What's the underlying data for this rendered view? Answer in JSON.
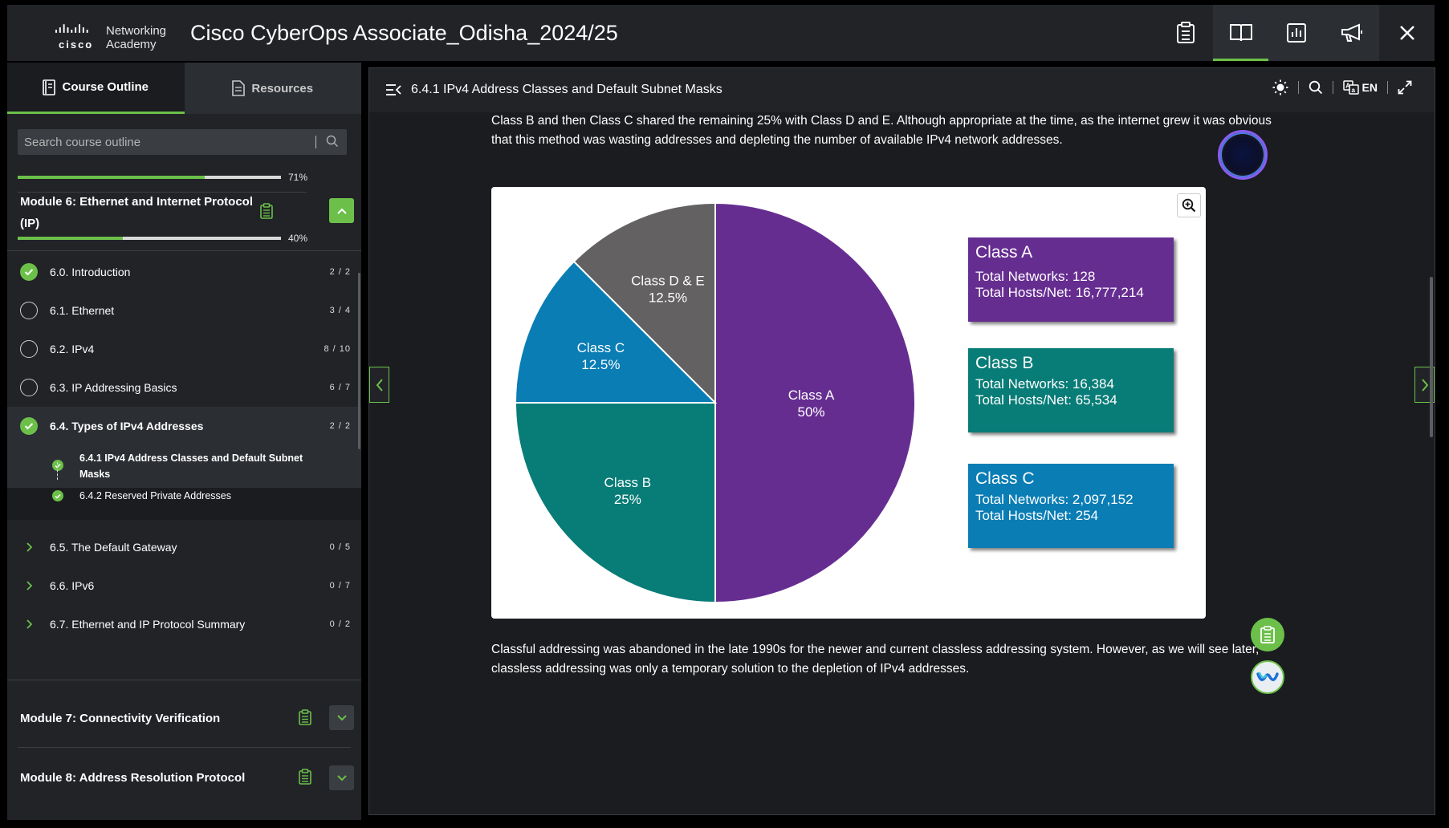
{
  "app": {
    "title": "Cisco CyberOps Associate_Odisha_2024/25",
    "logo_brand": "cisco",
    "logo_line1": "Networking",
    "logo_line2": "Academy"
  },
  "top_icons": [
    {
      "name": "assignments-icon",
      "active": false
    },
    {
      "name": "book-icon",
      "active": true
    },
    {
      "name": "grades-chart-icon",
      "active": false
    },
    {
      "name": "announcements-megaphone-icon",
      "active": false
    },
    {
      "name": "close-icon",
      "active": false
    }
  ],
  "sidebar": {
    "tabs": [
      {
        "label": "Course Outline",
        "icon": "outline-icon",
        "active": true
      },
      {
        "label": "Resources",
        "icon": "document-icon",
        "active": false
      }
    ],
    "search_placeholder": "Search course outline",
    "overall_progress": {
      "value": 0.71,
      "label": "71%"
    },
    "module6": {
      "title_line1": "Module 6: Ethernet and Internet Protocol",
      "title_line2": "(IP)",
      "progress": {
        "value": 0.4,
        "label": "40%"
      }
    },
    "items": [
      {
        "label": "6.0. Introduction",
        "count": "2 / 2",
        "status": "done"
      },
      {
        "label": "6.1. Ethernet",
        "count": "3 / 4",
        "status": "empty"
      },
      {
        "label": "6.2. IPv4",
        "count": "8 / 10",
        "status": "empty"
      },
      {
        "label": "6.3. IP Addressing Basics",
        "count": "6 / 7",
        "status": "empty"
      },
      {
        "label": "6.4. Types of IPv4 Addresses",
        "count": "2 / 2",
        "status": "done"
      }
    ],
    "sub_items": [
      {
        "label_line1": "6.4.1 IPv4 Address Classes and Default Subnet",
        "label_line2": "Masks"
      },
      {
        "label": "6.4.2 Reserved Private Addresses"
      }
    ],
    "collapsed_items": [
      {
        "label": "6.5. The Default Gateway",
        "count": "0 / 5"
      },
      {
        "label": "6.6. IPv6",
        "count": "0 / 7"
      },
      {
        "label": "6.7. Ethernet and IP Protocol Summary",
        "count": "0 / 2"
      }
    ],
    "other_modules": [
      {
        "title": "Module 7: Connectivity Verification"
      },
      {
        "title": "Module 8: Address Resolution Protocol"
      }
    ]
  },
  "main": {
    "page_title": "6.4.1 IPv4 Address Classes and Default Subnet Masks",
    "language": "EN",
    "intro_line1": "Class B and then Class C shared the remaining 25% with Class D and E. Although appropriate at the time, as the internet grew it was obvious",
    "intro_line2": "that this method was wasting addresses and depleting the number of available IPv4 network addresses.",
    "outro_line1": "Classful addressing was abandoned in the late 1990s for the newer and current classless addressing system. However, as we will see later,",
    "outro_line2": "classless addressing was only a temporary solution to the depletion of IPv4 addresses."
  },
  "chart_data": {
    "type": "pie",
    "title": "",
    "slices": [
      {
        "label": "Class A",
        "value_label": "50%",
        "value": 50,
        "color": "#662d91"
      },
      {
        "label": "Class B",
        "value_label": "25%",
        "value": 25,
        "color": "#087c77"
      },
      {
        "label": "Class C",
        "value_label": "12.5%",
        "value": 12.5,
        "color": "#0a7db5"
      },
      {
        "label": "Class D & E",
        "value_label": "12.5%",
        "value": 12.5,
        "color": "#646163"
      }
    ],
    "boxes": [
      {
        "title": "Class A",
        "networks": "Total Networks: 128",
        "hosts": "Total Hosts/Net: 16,777,214",
        "color": "#662d91"
      },
      {
        "title": "Class B",
        "networks": "Total Networks: 16,384",
        "hosts": "Total Hosts/Net: 65,534",
        "color": "#087c77"
      },
      {
        "title": "Class C",
        "networks": "Total Networks: 2,097,152",
        "hosts": "Total Hosts/Net: 254",
        "color": "#0a7db5"
      }
    ]
  },
  "colors": {
    "accent": "#6cc04a",
    "background": "#1a1c1f",
    "panel": "#212327"
  }
}
